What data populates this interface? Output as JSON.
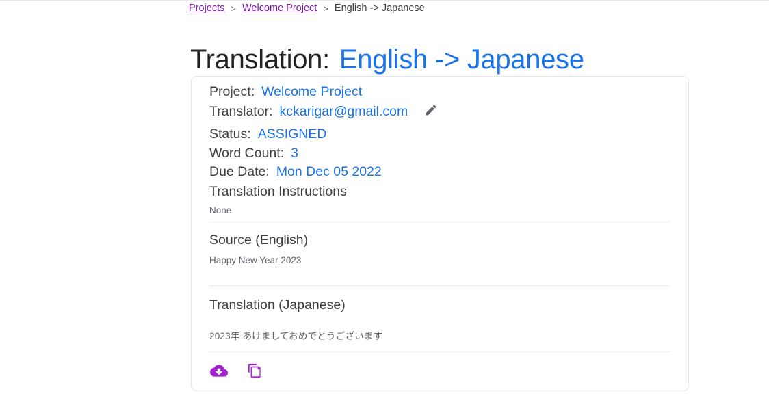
{
  "breadcrumb": {
    "items": [
      {
        "label": "Projects",
        "type": "link"
      },
      {
        "label": "Welcome Project",
        "type": "link"
      },
      {
        "label": "English -> Japanese",
        "type": "current"
      }
    ],
    "separator": ">"
  },
  "page_title": {
    "label": "Translation:",
    "value": "English -> Japanese"
  },
  "card": {
    "meta": {
      "project_label": "Project:",
      "project_value": "Welcome Project",
      "translator_label": "Translator:",
      "translator_value": "kckarigar@gmail.com",
      "edit_icon": "pencil-icon",
      "status_label": "Status:",
      "status_value": "ASSIGNED",
      "word_count_label": "Word Count:",
      "word_count_value": "3",
      "due_date_label": "Due Date:",
      "due_date_value": "Mon Dec 05 2022",
      "instructions_label": "Translation Instructions",
      "instructions_value": "None"
    },
    "source": {
      "title": "Source (English)",
      "text": "Happy New Year 2023"
    },
    "translation": {
      "title": "Translation (Japanese)",
      "text": "2023年 あけましておめでとうございます"
    },
    "actions": [
      {
        "name": "download-button",
        "icon": "cloud-download-icon"
      },
      {
        "name": "copy-button",
        "icon": "copy-icon"
      }
    ]
  },
  "colors": {
    "link_blue": "#1a73e8",
    "visited_purple": "#7b1fa2",
    "action_purple": "#a223cd",
    "text_primary": "#3c4043",
    "text_secondary": "#5f6368",
    "border": "#e4e6e8"
  }
}
